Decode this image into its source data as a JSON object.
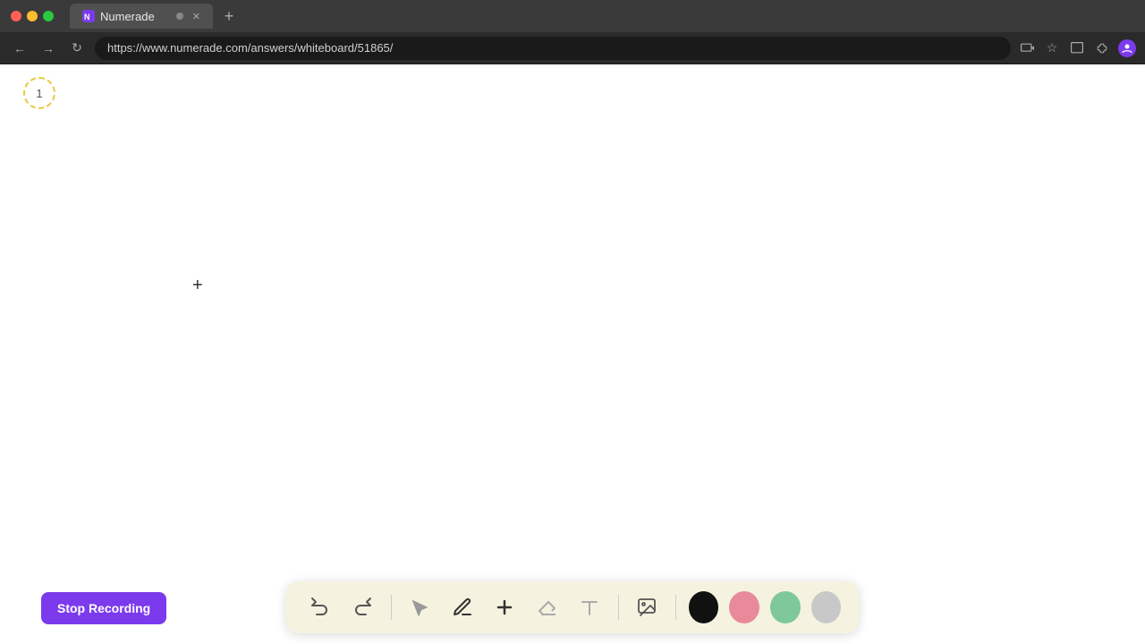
{
  "browser": {
    "title": "Numerade",
    "url": "https://www.numerade.com/answers/whiteboard/51865/",
    "tab_label": "Numerade",
    "tab_dot_color": "#888888",
    "new_tab_label": "+"
  },
  "nav": {
    "back_label": "←",
    "forward_label": "→",
    "refresh_label": "↻"
  },
  "page": {
    "number": "1"
  },
  "toolbar": {
    "undo_label": "↺",
    "redo_label": "↻",
    "select_label": "▶",
    "pen_label": "✏",
    "add_label": "+",
    "eraser_label": "⌫",
    "text_label": "A",
    "image_label": "🖼",
    "colors": [
      "#111111",
      "#e88a9a",
      "#7ec89a",
      "#c8c8c8"
    ]
  },
  "stop_recording": {
    "label": "Stop Recording"
  }
}
